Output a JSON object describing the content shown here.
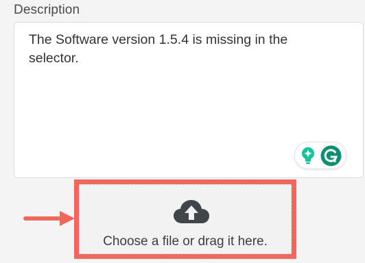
{
  "description_field": {
    "label": "Description",
    "value": "The Software version 1.5.4 is missing in the selector."
  },
  "grammarly_widget": {
    "icons": [
      "suggestion-bulb-icon",
      "grammarly-logo-icon"
    ],
    "accent_color": "#15c39a",
    "logo_color": "#0e8f72"
  },
  "file_upload": {
    "icon": "cloud-upload-icon",
    "prompt": "Choose a file or drag it here.",
    "highlight_color": "#f0675c"
  },
  "annotation": {
    "icon": "right-arrow-icon",
    "color": "#f0675c"
  }
}
